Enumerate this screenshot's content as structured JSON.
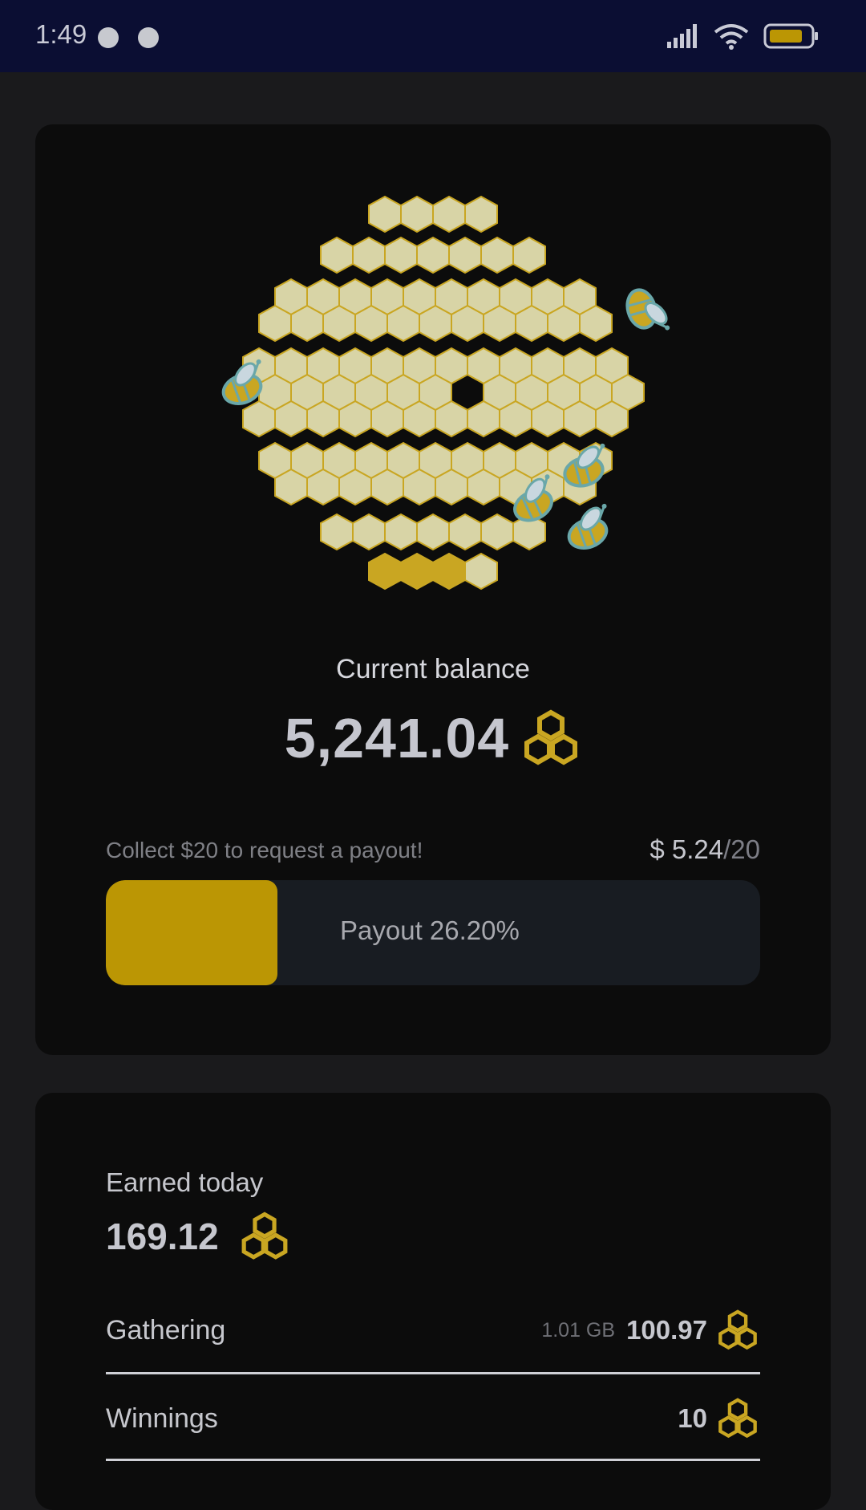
{
  "status_bar": {
    "time": "1:49"
  },
  "balance": {
    "label": "Current balance",
    "value": "5,241.04"
  },
  "payout": {
    "hint": "Collect $20 to request a payout!",
    "amount": "$ 5.24",
    "goal": "/20",
    "label": "Payout 26.20%",
    "progress_fraction": 0.262
  },
  "earnings": {
    "label": "Earned today",
    "value": "169.12",
    "rows": [
      {
        "label": "Gathering",
        "sub": "1.01 GB",
        "value": "100.97"
      },
      {
        "label": "Winnings",
        "sub": "",
        "value": "10"
      }
    ]
  },
  "colors": {
    "accent_gold": "#bb9604",
    "honey_cell": "#d8d4a6",
    "cell_border": "#c9a622",
    "status_bar": "#0b0e33",
    "card": "#0c0c0c"
  },
  "icons": [
    "app-notification-icon",
    "app-notification-icon-2",
    "signal-icon",
    "wifi-icon",
    "battery-icon",
    "honeycomb-icon",
    "bee-icon"
  ]
}
